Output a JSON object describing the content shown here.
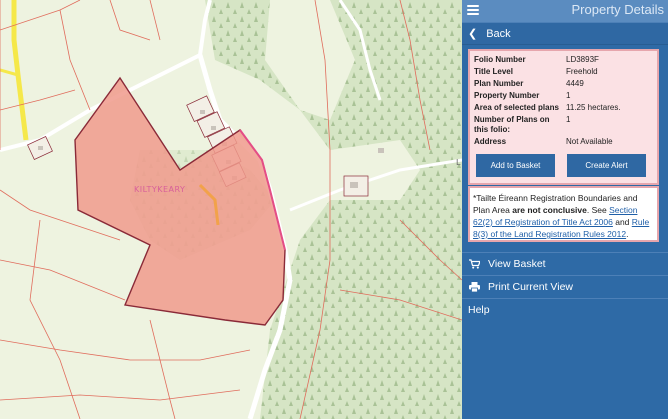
{
  "panel": {
    "title": "Property Details",
    "back_label": "Back",
    "details": [
      {
        "label": "Folio Number",
        "value": "LD3893F"
      },
      {
        "label": "Title Level",
        "value": "Freehold"
      },
      {
        "label": "Plan Number",
        "value": "4449"
      },
      {
        "label": "Property Number",
        "value": "1"
      },
      {
        "label": "Area of selected plans",
        "value": "11.25 hectares."
      },
      {
        "label": "Number of Plans on this folio:",
        "value": "1"
      },
      {
        "label": "Address",
        "value": "Not Available"
      }
    ],
    "add_to_basket_label": "Add to Basket",
    "create_alert_label": "Create Alert",
    "disclaimer": {
      "prefix": "*Tailte Éireann Registration Boundaries and Plan Area ",
      "bold": "are not conclusive",
      "mid1": ". See ",
      "link1": "Section 62(2) of Registration of Title Act 2006",
      "mid2": " and ",
      "link2": "Rule 8(3) of the Land Registration Rules 2012",
      "suffix": "."
    },
    "view_basket_label": "View Basket",
    "print_label": "Print Current View",
    "help_label": "Help"
  },
  "map": {
    "place_label": "KILTYKEARY",
    "edge_label": "L",
    "colors": {
      "field": "#eef3e0",
      "forest": "#d6e5c5",
      "parcel_fill": "#f09a8c",
      "parcel_stroke": "#8a2a38",
      "boundary": "#e06c5c",
      "road_yellow": "#f5e84a"
    }
  }
}
